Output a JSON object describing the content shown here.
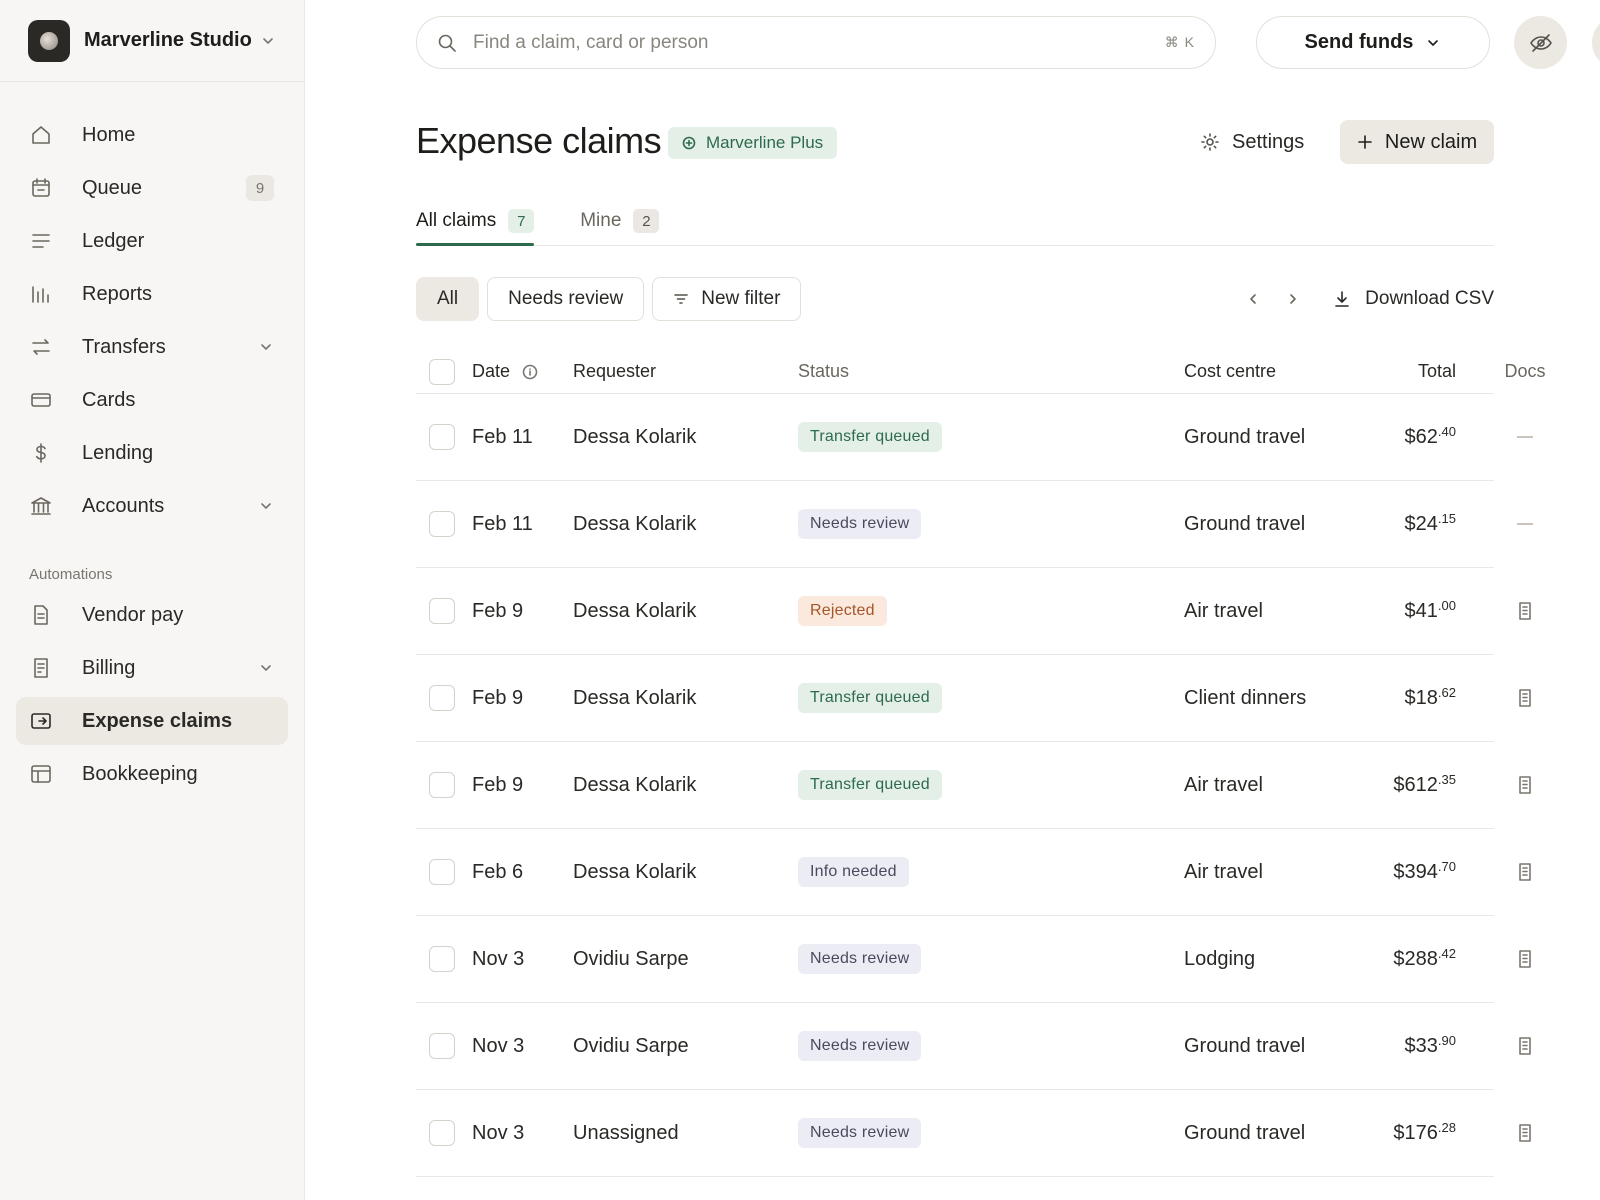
{
  "workspace": {
    "name": "Marverline Studio"
  },
  "sidebar": {
    "items": [
      {
        "label": "Home",
        "icon": "home-icon"
      },
      {
        "label": "Queue",
        "icon": "calendar-icon",
        "count": "9"
      },
      {
        "label": "Ledger",
        "icon": "lines-icon"
      },
      {
        "label": "Reports",
        "icon": "bar-chart-icon"
      },
      {
        "label": "Transfers",
        "icon": "transfer-arrows-icon",
        "expandable": true
      },
      {
        "label": "Cards",
        "icon": "card-icon"
      },
      {
        "label": "Lending",
        "icon": "dollar-icon"
      },
      {
        "label": "Accounts",
        "icon": "bank-icon",
        "expandable": true
      }
    ],
    "section_label": "Automations",
    "automation_items": [
      {
        "label": "Vendor pay",
        "icon": "document-icon"
      },
      {
        "label": "Billing",
        "icon": "receipt-icon",
        "expandable": true
      },
      {
        "label": "Expense claims",
        "icon": "expense-icon",
        "active": true
      },
      {
        "label": "Bookkeeping",
        "icon": "table-icon"
      }
    ]
  },
  "topbar": {
    "search_placeholder": "Find a claim, card or person",
    "search_shortcut": "⌘ K",
    "send_funds_label": "Send funds"
  },
  "header": {
    "title": "Expense claims",
    "plan_badge": "Marverline Plus",
    "settings_label": "Settings",
    "new_claim_label": "New claim"
  },
  "tabs": [
    {
      "label": "All claims",
      "count": "7",
      "active": true
    },
    {
      "label": "Mine",
      "count": "2",
      "active": false
    }
  ],
  "filters": {
    "all_label": "All",
    "needs_review_label": "Needs review",
    "new_filter_label": "New filter",
    "download_label": "Download CSV"
  },
  "table": {
    "headers": {
      "date": "Date",
      "requester": "Requester",
      "status": "Status",
      "total": "Total",
      "cost_centre": "Cost centre",
      "docs": "Docs"
    },
    "rows": [
      {
        "date": "Feb 11",
        "requester": "Dessa Kolarik",
        "status": "Transfer queued",
        "status_kind": "queued",
        "amount": "$62",
        "cents": ".40",
        "cost_centre": "Ground travel",
        "docs": "none"
      },
      {
        "date": "Feb 11",
        "requester": "Dessa Kolarik",
        "status": "Needs review",
        "status_kind": "review",
        "amount": "$24",
        "cents": ".15",
        "cost_centre": "Ground travel",
        "docs": "none"
      },
      {
        "date": "Feb 9",
        "requester": "Dessa Kolarik",
        "status": "Rejected",
        "status_kind": "rejected",
        "amount": "$41",
        "cents": ".00",
        "cost_centre": "Air travel",
        "docs": "receipt"
      },
      {
        "date": "Feb 9",
        "requester": "Dessa Kolarik",
        "status": "Transfer queued",
        "status_kind": "queued",
        "amount": "$18",
        "cents": ".62",
        "cost_centre": "Client dinners",
        "docs": "receipt"
      },
      {
        "date": "Feb 9",
        "requester": "Dessa Kolarik",
        "status": "Transfer queued",
        "status_kind": "queued",
        "amount": "$612",
        "cents": ".35",
        "cost_centre": "Air travel",
        "docs": "receipt"
      },
      {
        "date": "Feb 6",
        "requester": "Dessa Kolarik",
        "status": "Info needed",
        "status_kind": "info",
        "amount": "$394",
        "cents": ".70",
        "cost_centre": "Air travel",
        "docs": "receipt"
      },
      {
        "date": "Nov 3",
        "requester": "Ovidiu Sarpe",
        "status": "Needs review",
        "status_kind": "review",
        "amount": "$288",
        "cents": ".42",
        "cost_centre": "Lodging",
        "docs": "receipt"
      },
      {
        "date": "Nov 3",
        "requester": "Ovidiu Sarpe",
        "status": "Needs review",
        "status_kind": "review",
        "amount": "$33",
        "cents": ".90",
        "cost_centre": "Ground travel",
        "docs": "receipt"
      },
      {
        "date": "Nov 3",
        "requester": "Unassigned",
        "status": "Needs review",
        "status_kind": "review",
        "amount": "$176",
        "cents": ".28",
        "cost_centre": "Ground travel",
        "docs": "receipt"
      }
    ]
  },
  "colors": {
    "accent_green": "#2e6b4c",
    "sidebar_bg": "#f7f6f4",
    "active_bg": "#ece9e3"
  }
}
